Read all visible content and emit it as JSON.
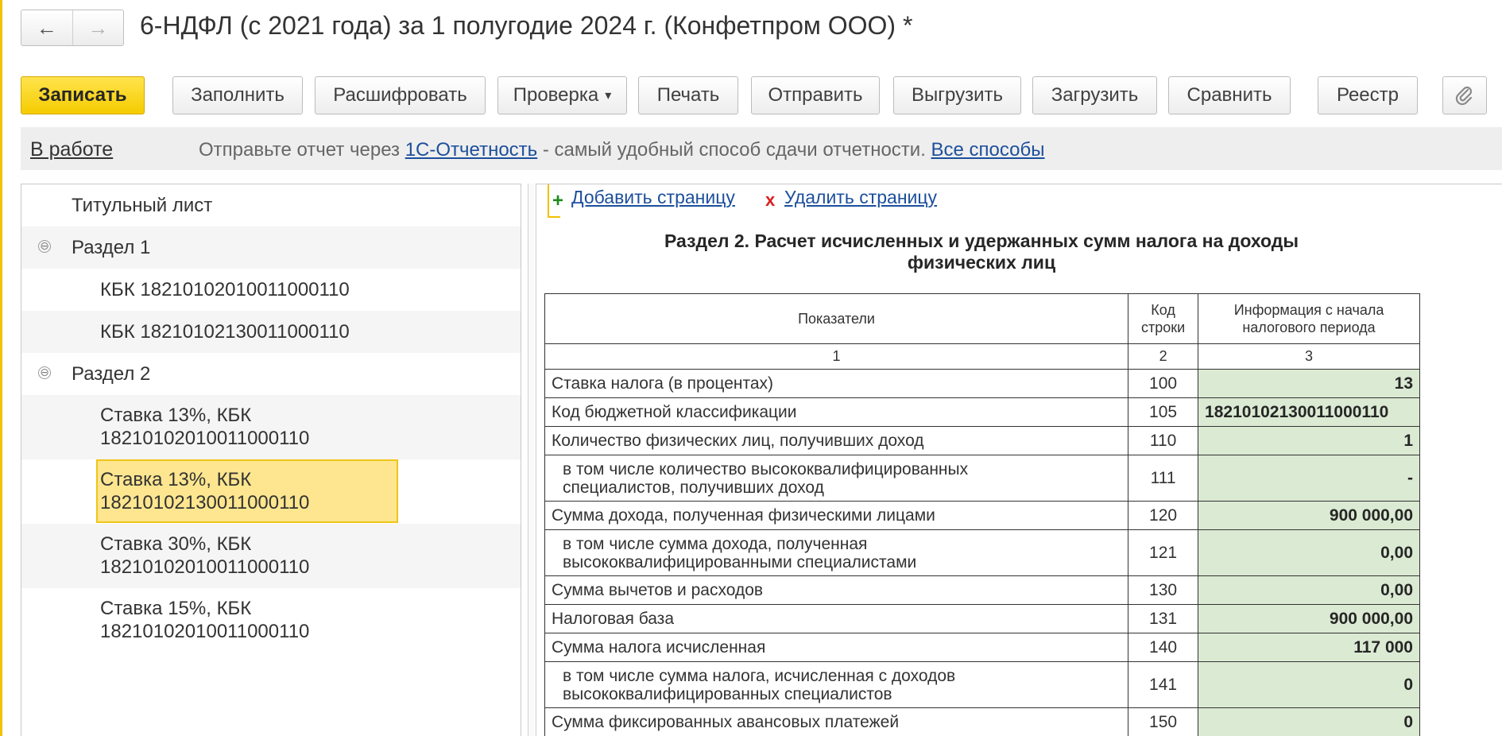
{
  "window": {
    "title": "6-НДФЛ (с 2021 года) за 1 полугодие 2024 г. (Конфетпром ООО) *",
    "back_icon": "←",
    "forward_icon": "→"
  },
  "toolbar": {
    "save": "Записать",
    "fill": "Заполнить",
    "decode": "Расшифровать",
    "check": "Проверка",
    "check_caret": "▾",
    "print": "Печать",
    "send": "Отправить",
    "export": "Выгрузить",
    "import": "Загрузить",
    "compare": "Сравнить",
    "registry": "Реестр",
    "attach_icon": "paperclip-icon"
  },
  "infobar": {
    "status": "В работе",
    "text_before": "Отправьте отчет через ",
    "service_link": "1С-Отчетность",
    "text_after": " - самый удобный способ сдачи отчетности. ",
    "all_methods_link": "Все способы"
  },
  "tree": {
    "title_page": "Титульный лист",
    "section1": "Раздел 1",
    "section1_items": [
      "КБК 18210102010011000110",
      "КБК 18210102130011000110"
    ],
    "section2": "Раздел 2",
    "section2_items": [
      {
        "line1": "Ставка 13%, КБК",
        "line2": "18210102010011000110"
      },
      {
        "line1": "Ставка 13%, КБК",
        "line2": "18210102130011000110"
      },
      {
        "line1": "Ставка 30%, КБК",
        "line2": "18210102010011000110"
      },
      {
        "line1": "Ставка 15%, КБК",
        "line2": "18210102010011000110"
      }
    ],
    "toggle_symbol": "⊖"
  },
  "page_actions": {
    "add_icon": "+",
    "add": "Добавить страницу",
    "delete_icon": "x",
    "delete": "Удалить страницу"
  },
  "report": {
    "section_title_line1": "Раздел 2. Расчет исчисленных и удержанных сумм налога на доходы",
    "section_title_line2": "физических лиц",
    "headers": {
      "indicators": "Показатели",
      "code_line1": "Код",
      "code_line2": "строки",
      "info_line1": "Информация с начала",
      "info_line2": "налогового периода"
    },
    "col_numbers": [
      "1",
      "2",
      "3"
    ],
    "rows": [
      {
        "label": "Ставка налога (в процентах)",
        "code": "100",
        "value": "13"
      },
      {
        "label": "Код бюджетной классификации",
        "code": "105",
        "value": "18210102130011000110"
      },
      {
        "label": "Количество физических лиц, получивших доход",
        "code": "110",
        "value": "1"
      },
      {
        "label_line1": "в том числе количество высококвалифицированных",
        "label_line2": "специалистов, получивших доход",
        "code": "111",
        "value": "-"
      },
      {
        "label": "Сумма дохода, полученная физическими лицами",
        "code": "120",
        "value": "900 000,00"
      },
      {
        "label_line1": "в том числе сумма дохода, полученная",
        "label_line2": "высококвалифицированными специалистами",
        "code": "121",
        "value": "0,00"
      },
      {
        "label": "Сумма вычетов и расходов",
        "code": "130",
        "value": "0,00"
      },
      {
        "label": "Налоговая база",
        "code": "131",
        "value": "900 000,00"
      },
      {
        "label": "Сумма налога исчисленная",
        "code": "140",
        "value": "117 000"
      },
      {
        "label_line1": "в том числе сумма налога, исчисленная с доходов",
        "label_line2": "высококвалифицированных специалистов",
        "code": "141",
        "value": "0"
      },
      {
        "label": "Сумма фиксированных авансовых платежей",
        "code": "150",
        "value": "0"
      }
    ]
  },
  "colors": {
    "accent_yellow": "#f5cc00",
    "selected_bg": "#fde68f",
    "editable_cell_bg": "#dbead3",
    "link": "#1c4f9c"
  }
}
